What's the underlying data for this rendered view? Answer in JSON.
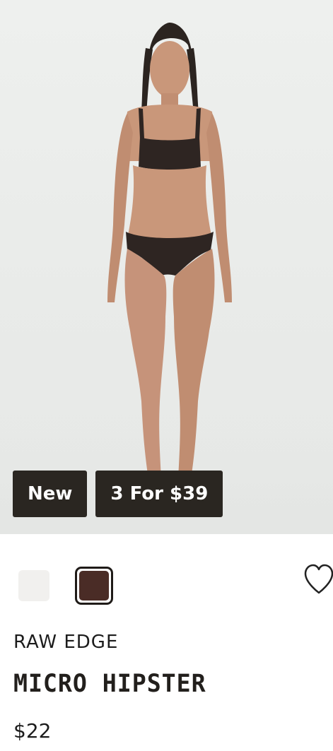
{
  "product": {
    "badges": [
      "New",
      "3 For $39"
    ],
    "swatches": [
      {
        "name": "white",
        "color": "#f1f0ee",
        "selected": false
      },
      {
        "name": "brown",
        "color": "#4a2c26",
        "selected": true
      }
    ],
    "wishlist_icon": "heart-outline-icon",
    "collection": "RAW EDGE",
    "title": "MICRO HIPSTER",
    "price": "$22"
  }
}
